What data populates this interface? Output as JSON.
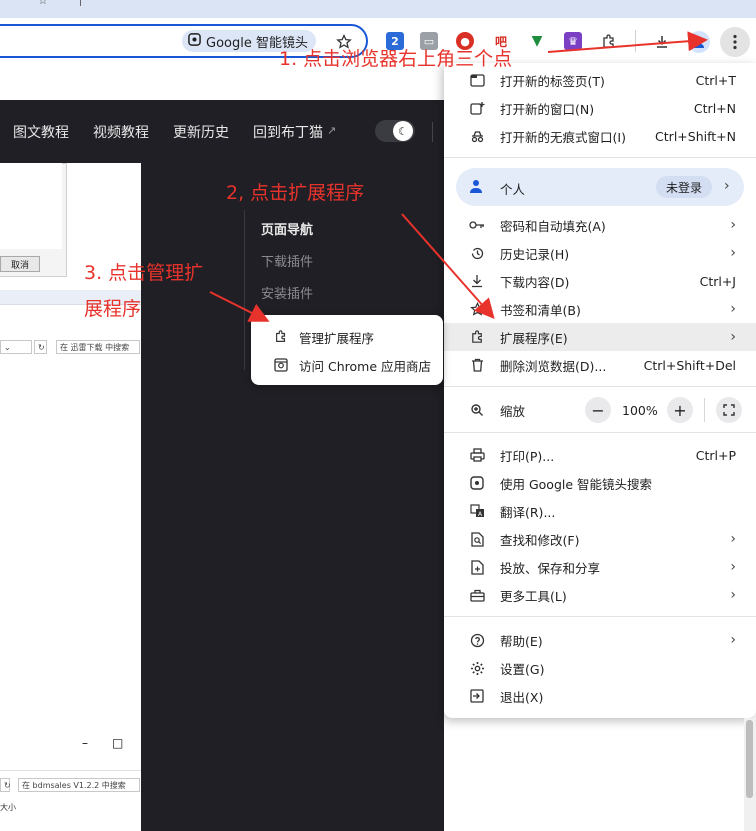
{
  "browser": {
    "lens_label": "Google 智能镜头"
  },
  "site_nav": {
    "links": [
      "图文教程",
      "视频教程",
      "更新历史",
      "回到布丁猫"
    ],
    "external_mark": "↗"
  },
  "toc": {
    "title": "页面导航",
    "items": [
      "下载插件",
      "安装插件"
    ]
  },
  "left_shot": {
    "cancel": "取消",
    "search_top": "在 迅雷下载 中搜索",
    "search_bottom": "在 bdmsales V1.2.2 中搜索",
    "size_label": "大小",
    "win_min": "–",
    "win_max": "□"
  },
  "annotations": {
    "step1": "1. 点击浏览器右上角三个点",
    "step2": "2, 点击扩展程序",
    "step3_line1": "3. 点击管理扩",
    "step3_line2": "展程序",
    "color": "#e8332c"
  },
  "submenu": {
    "items": [
      {
        "label": "管理扩展程序",
        "icon": "puzzle-icon"
      },
      {
        "label": "访问 Chrome 应用商店",
        "icon": "store-icon"
      }
    ]
  },
  "menu": {
    "new_tab": {
      "label": "打开新的标签页(T)",
      "shortcut": "Ctrl+T"
    },
    "new_window": {
      "label": "打开新的窗口(N)",
      "shortcut": "Ctrl+N"
    },
    "incognito": {
      "label": "打开新的无痕式窗口(I)",
      "shortcut": "Ctrl+Shift+N"
    },
    "profile": {
      "label": "个人",
      "status": "未登录"
    },
    "passwords": {
      "label": "密码和自动填充(A)"
    },
    "history": {
      "label": "历史记录(H)"
    },
    "downloads": {
      "label": "下载内容(D)",
      "shortcut": "Ctrl+J"
    },
    "bookmarks": {
      "label": "书签和清单(B)"
    },
    "extensions": {
      "label": "扩展程序(E)"
    },
    "clear_data": {
      "label": "删除浏览数据(D)...",
      "shortcut": "Ctrl+Shift+Del"
    },
    "zoom": {
      "label": "缩放",
      "value": "100%",
      "minus": "−",
      "plus": "+"
    },
    "print": {
      "label": "打印(P)...",
      "shortcut": "Ctrl+P"
    },
    "lens_search": {
      "label": "使用 Google 智能镜头搜索"
    },
    "translate": {
      "label": "翻译(R)..."
    },
    "find_edit": {
      "label": "查找和修改(F)"
    },
    "cast_save": {
      "label": "投放、保存和分享"
    },
    "more_tools": {
      "label": "更多工具(L)"
    },
    "help": {
      "label": "帮助(E)"
    },
    "settings": {
      "label": "设置(G)"
    },
    "exit": {
      "label": "退出(X)"
    }
  }
}
